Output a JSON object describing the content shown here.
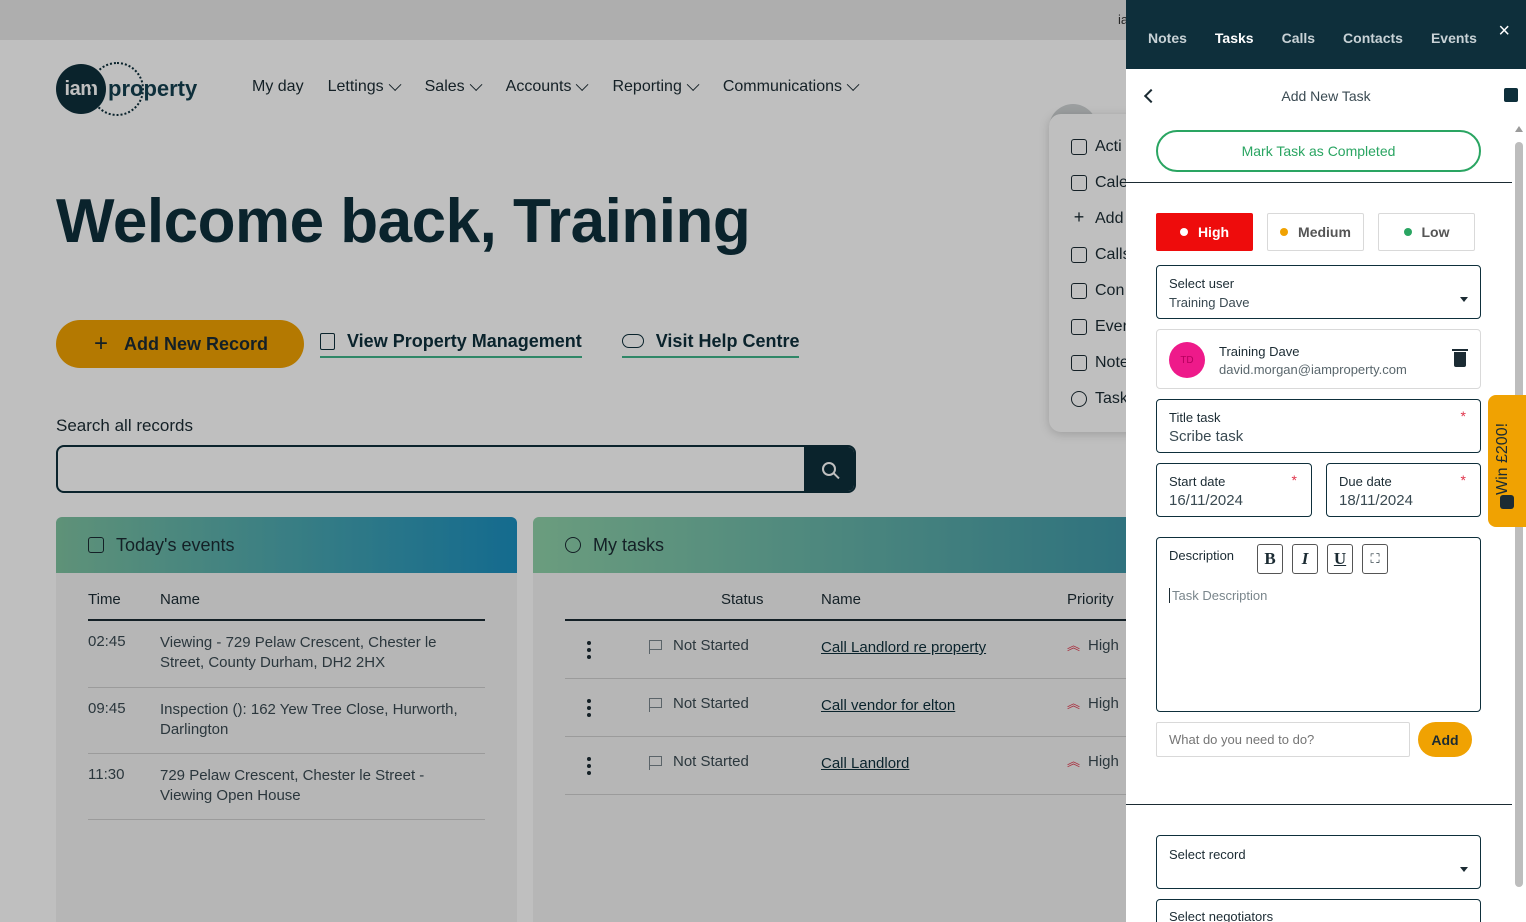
{
  "topstrip": {
    "truncated_text": "ia"
  },
  "logo": {
    "circle_text": "iam",
    "word": "property"
  },
  "nav": {
    "items": [
      "My day",
      "Lettings",
      "Sales",
      "Accounts",
      "Reporting",
      "Communications"
    ]
  },
  "quickmenu": {
    "items": [
      "Acti",
      "Cale",
      "Add",
      "Calls",
      "Con",
      "Even",
      "Note",
      "Task"
    ]
  },
  "welcome": "Welcome back, Training",
  "actions": {
    "add_record": "Add New Record",
    "view_pm": "View Property Management",
    "help": "Visit Help Centre"
  },
  "search": {
    "label": "Search all records",
    "value": ""
  },
  "events": {
    "title": "Today's events",
    "columns": [
      "Time",
      "Name"
    ],
    "rows": [
      {
        "time": "02:45",
        "name": "Viewing - 729 Pelaw Crescent, Chester le Street, County Durham, DH2 2HX"
      },
      {
        "time": "09:45",
        "name": "Inspection (): 162 Yew Tree Close, Hurworth, Darlington"
      },
      {
        "time": "11:30",
        "name": "729 Pelaw Crescent, Chester le Street - Viewing Open House"
      }
    ]
  },
  "tasks": {
    "title": "My tasks",
    "columns": [
      "Status",
      "Name",
      "Priority"
    ],
    "rows": [
      {
        "status": "Not Started",
        "name": "Call Landlord re property",
        "priority": "High"
      },
      {
        "status": "Not Started",
        "name": "Call vendor for elton",
        "priority": "High"
      },
      {
        "status": "Not Started",
        "name": "Call Landlord",
        "priority": "High"
      }
    ]
  },
  "panel": {
    "tabs": [
      "Notes",
      "Tasks",
      "Calls",
      "Contacts",
      "Events"
    ],
    "active_tab": "Tasks",
    "close": "×",
    "title": "Add New Task",
    "mark_completed": "Mark Task as Completed",
    "priority": {
      "high": "High",
      "medium": "Medium",
      "low": "Low",
      "selected": "High"
    },
    "select_user": {
      "label": "Select user",
      "value": "Training Dave"
    },
    "user": {
      "initials": "TD",
      "name": "Training Dave",
      "email": "david.morgan@iamproperty.com"
    },
    "title_task": {
      "label": "Title task",
      "value": "Scribe task",
      "required": "*"
    },
    "start_date": {
      "label": "Start date",
      "value": "16/11/2024",
      "required": "*"
    },
    "due_date": {
      "label": "Due date",
      "value": "18/11/2024",
      "required": "*"
    },
    "description": {
      "label": "Description",
      "tools": [
        "B",
        "I",
        "U",
        "⛶"
      ],
      "placeholder": "Task Description"
    },
    "todo": {
      "placeholder": "What do you need to do?",
      "add": "Add"
    },
    "select_record": {
      "label": "Select record"
    },
    "select_negotiators": {
      "label": "Select negotiators"
    }
  },
  "win_tab": {
    "text": "Win £200!"
  },
  "colors": {
    "navy": "#0e2f3b",
    "accent_orange": "#f0a202",
    "high_red": "#ee0c0c",
    "green": "#2aa562"
  }
}
